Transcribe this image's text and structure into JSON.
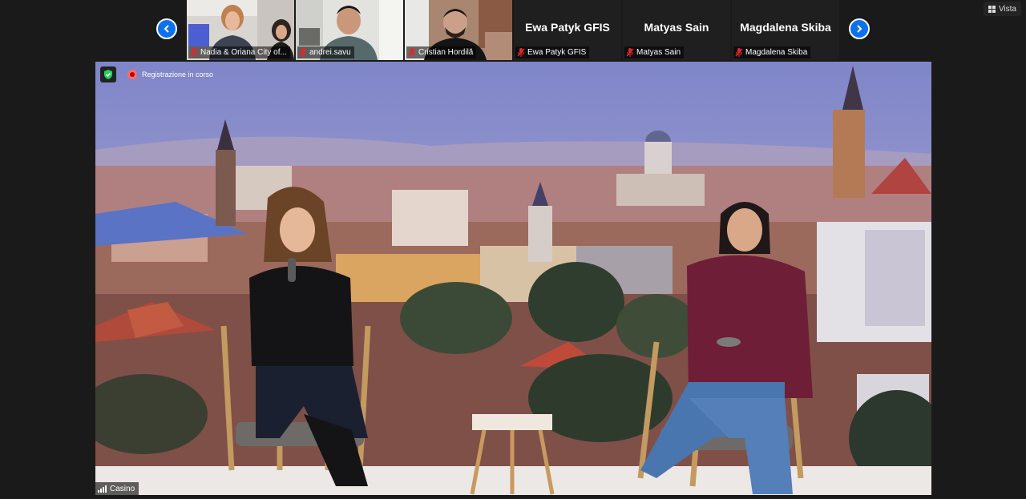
{
  "navigation": {
    "prev_icon": "chevron-left-icon",
    "next_icon": "chevron-right-icon"
  },
  "view_button": {
    "icon": "grid-icon",
    "label": "Vista"
  },
  "participants": [
    {
      "name": "Nadia & Oriana City of...",
      "display": "video",
      "muted": true
    },
    {
      "name": "andrei.savu",
      "display": "video",
      "muted": true
    },
    {
      "name": "Cristian Hordilă",
      "display": "video",
      "muted": true
    },
    {
      "name": "Ewa Patyk GFIS",
      "display": "name",
      "muted": true
    },
    {
      "name": "Matyas Sain",
      "display": "name",
      "muted": true
    },
    {
      "name": "Magdalena Skiba",
      "display": "name",
      "muted": true
    }
  ],
  "main_video": {
    "recording_status": "Registrazione in corso",
    "speaker_name": "Casino",
    "icons": [
      "shield-check-icon",
      "record-icon",
      "signal-bars-icon"
    ]
  },
  "colors": {
    "accent": "#0e71eb",
    "muted_mic": "#e02828",
    "encryption": "#23d160"
  }
}
